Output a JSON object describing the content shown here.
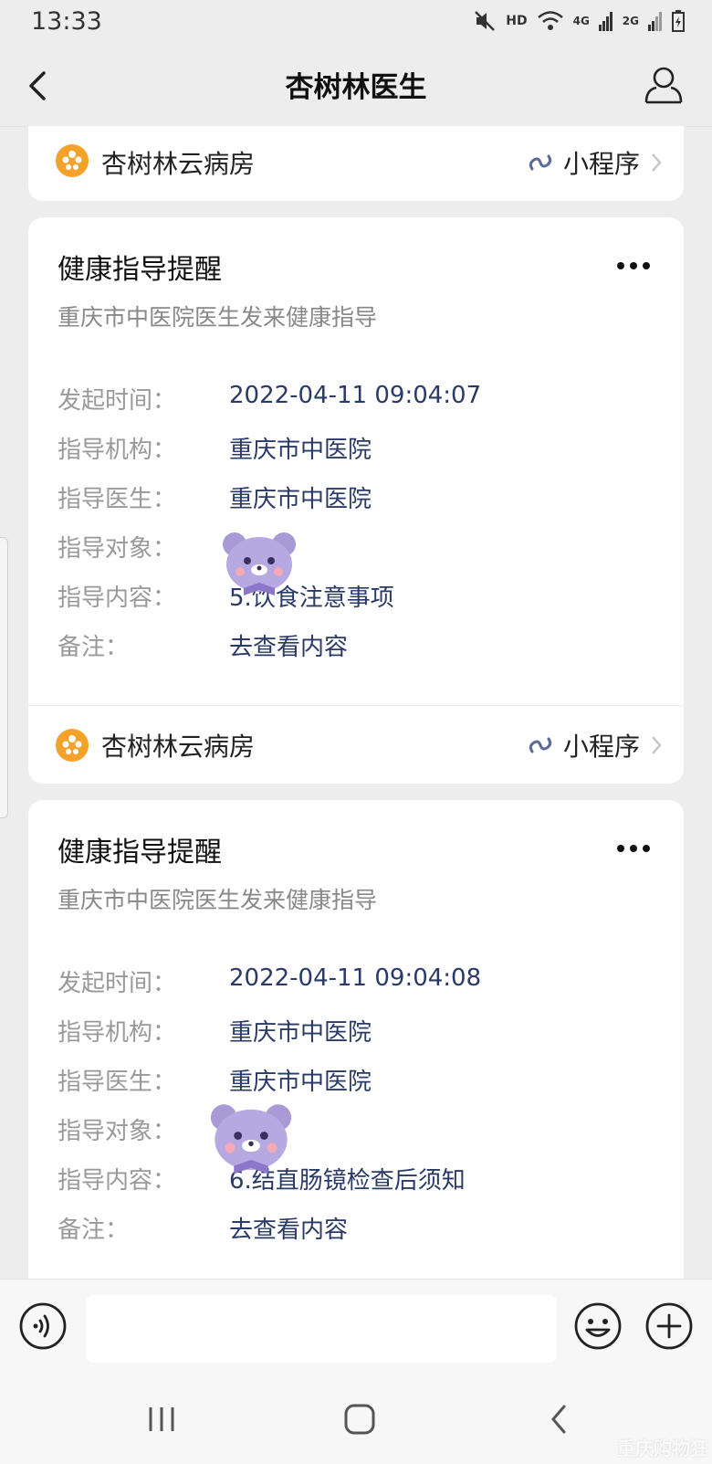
{
  "status_bar": {
    "time": "13:33",
    "hd_label": "HD",
    "net_4g": "4G",
    "net_2g": "2G"
  },
  "nav": {
    "title": "杏树林医生"
  },
  "mini_program": {
    "name": "杏树林云病房",
    "link_label": "小程序"
  },
  "messages": [
    {
      "title": "健康指导提醒",
      "subtitle": "重庆市中医院医生发来健康指导",
      "fields": [
        {
          "label": "发起时间：",
          "value": "2022-04-11 09:04:07"
        },
        {
          "label": "指导机构：",
          "value": "重庆市中医院"
        },
        {
          "label": "指导医生：",
          "value": "重庆市中医院"
        },
        {
          "label": "指导对象：",
          "value": ""
        },
        {
          "label": "指导内容：",
          "value": "5.饮食注意事项"
        },
        {
          "label": "备注：",
          "value": "去查看内容"
        }
      ],
      "mini_program": {
        "name": "杏树林云病房",
        "link_label": "小程序"
      }
    },
    {
      "title": "健康指导提醒",
      "subtitle": "重庆市中医院医生发来健康指导",
      "fields": [
        {
          "label": "发起时间：",
          "value": "2022-04-11 09:04:08"
        },
        {
          "label": "指导机构：",
          "value": "重庆市中医院"
        },
        {
          "label": "指导医生：",
          "value": "重庆市中医院"
        },
        {
          "label": "指导对象：",
          "value": ""
        },
        {
          "label": "指导内容：",
          "value": "6.结直肠镜检查后须知"
        },
        {
          "label": "备注：",
          "value": "去查看内容"
        }
      ]
    }
  ],
  "input_bar": {
    "placeholder": ""
  },
  "watermark": "重庆购物狂",
  "colors": {
    "background": "#ededed",
    "card": "#ffffff",
    "value_text": "#2a3a66",
    "label_text": "#999999",
    "logo_orange": "#f5a12a",
    "mini_icon": "#5a6a9a",
    "sticker": "#a99ad6"
  }
}
